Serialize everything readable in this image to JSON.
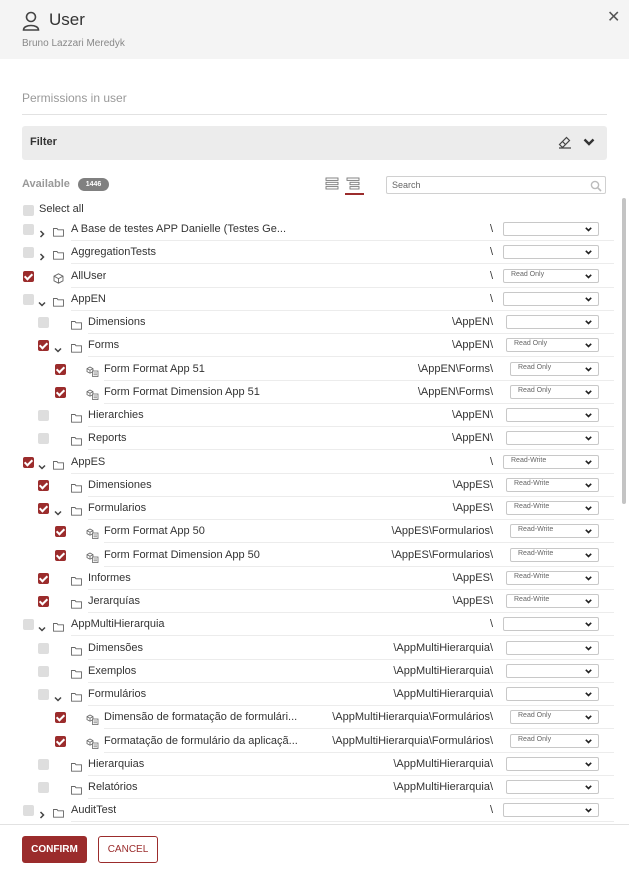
{
  "header": {
    "title": "User",
    "subtitle": "Bruno Lazzari Meredyk",
    "close_symbol": "✕"
  },
  "section_title": "Permissions in user",
  "filter": {
    "label": "Filter"
  },
  "available": {
    "label": "Available",
    "count": "1446"
  },
  "search": {
    "placeholder": "Search"
  },
  "select_all": "Select all",
  "colors": {
    "accent": "#9b2c2c",
    "header_bg": "#f4f4f4",
    "filter_bg": "#ececec"
  },
  "tree": [
    {
      "name": "A Base de testes APP Danielle (Testes Ge...",
      "path": "\\",
      "level": 0,
      "type": "folder",
      "toggle": "collapsed",
      "checked": false,
      "access": ""
    },
    {
      "name": "AggregationTests",
      "path": "\\",
      "level": 0,
      "type": "folder",
      "toggle": "collapsed",
      "checked": false,
      "access": ""
    },
    {
      "name": "AllUser",
      "path": "\\",
      "level": 0,
      "type": "cube",
      "toggle": "none",
      "checked": true,
      "access": "Read Only"
    },
    {
      "name": "AppEN",
      "path": "\\",
      "level": 0,
      "type": "folder",
      "toggle": "expanded",
      "checked": false,
      "access": ""
    },
    {
      "name": "Dimensions",
      "path": "\\AppEN\\",
      "level": 1,
      "type": "folder",
      "toggle": "none",
      "checked": false,
      "access": ""
    },
    {
      "name": "Forms",
      "path": "\\AppEN\\",
      "level": 1,
      "type": "folder",
      "toggle": "expanded",
      "checked": true,
      "access": "Read Only"
    },
    {
      "name": "Form Format App 51",
      "path": "\\AppEN\\Forms\\",
      "level": 2,
      "type": "form",
      "toggle": "none",
      "checked": true,
      "access": "Read Only"
    },
    {
      "name": "Form Format Dimension App 51",
      "path": "\\AppEN\\Forms\\",
      "level": 2,
      "type": "form",
      "toggle": "none",
      "checked": true,
      "access": "Read Only"
    },
    {
      "name": "Hierarchies",
      "path": "\\AppEN\\",
      "level": 1,
      "type": "folder",
      "toggle": "none",
      "checked": false,
      "access": ""
    },
    {
      "name": "Reports",
      "path": "\\AppEN\\",
      "level": 1,
      "type": "folder",
      "toggle": "none",
      "checked": false,
      "access": ""
    },
    {
      "name": "AppES",
      "path": "\\",
      "level": 0,
      "type": "folder",
      "toggle": "expanded",
      "checked": true,
      "access": "Read-Write"
    },
    {
      "name": "Dimensiones",
      "path": "\\AppES\\",
      "level": 1,
      "type": "folder",
      "toggle": "none",
      "checked": true,
      "access": "Read-Write"
    },
    {
      "name": "Formularios",
      "path": "\\AppES\\",
      "level": 1,
      "type": "folder",
      "toggle": "expanded",
      "checked": true,
      "access": "Read-Write"
    },
    {
      "name": "Form Format App 50",
      "path": "\\AppES\\Formularios\\",
      "level": 2,
      "type": "form",
      "toggle": "none",
      "checked": true,
      "access": "Read-Write"
    },
    {
      "name": "Form Format Dimension App 50",
      "path": "\\AppES\\Formularios\\",
      "level": 2,
      "type": "form",
      "toggle": "none",
      "checked": true,
      "access": "Read-Write"
    },
    {
      "name": "Informes",
      "path": "\\AppES\\",
      "level": 1,
      "type": "folder",
      "toggle": "none",
      "checked": true,
      "access": "Read-Write"
    },
    {
      "name": "Jerarquías",
      "path": "\\AppES\\",
      "level": 1,
      "type": "folder",
      "toggle": "none",
      "checked": true,
      "access": "Read-Write"
    },
    {
      "name": "AppMultiHierarquia",
      "path": "\\",
      "level": 0,
      "type": "folder",
      "toggle": "expanded",
      "checked": false,
      "access": ""
    },
    {
      "name": "Dimensões",
      "path": "\\AppMultiHierarquia\\",
      "level": 1,
      "type": "folder",
      "toggle": "none",
      "checked": false,
      "access": ""
    },
    {
      "name": "Exemplos",
      "path": "\\AppMultiHierarquia\\",
      "level": 1,
      "type": "folder",
      "toggle": "none",
      "checked": false,
      "access": ""
    },
    {
      "name": "Formulários",
      "path": "\\AppMultiHierarquia\\",
      "level": 1,
      "type": "folder",
      "toggle": "expanded",
      "checked": false,
      "access": ""
    },
    {
      "name": "Dimensão de formatação de formulári...",
      "path": "\\AppMultiHierarquia\\Formulários\\",
      "level": 2,
      "type": "form",
      "toggle": "none",
      "checked": true,
      "access": "Read Only"
    },
    {
      "name": "Formatação de formulário da aplicaçã...",
      "path": "\\AppMultiHierarquia\\Formulários\\",
      "level": 2,
      "type": "form",
      "toggle": "none",
      "checked": true,
      "access": "Read Only"
    },
    {
      "name": "Hierarquias",
      "path": "\\AppMultiHierarquia\\",
      "level": 1,
      "type": "folder",
      "toggle": "none",
      "checked": false,
      "access": ""
    },
    {
      "name": "Relatórios",
      "path": "\\AppMultiHierarquia\\",
      "level": 1,
      "type": "folder",
      "toggle": "none",
      "checked": false,
      "access": ""
    },
    {
      "name": "AuditTest",
      "path": "\\",
      "level": 0,
      "type": "folder",
      "toggle": "collapsed",
      "checked": false,
      "access": ""
    }
  ],
  "buttons": {
    "confirm": "CONFIRM",
    "cancel": "CANCEL"
  }
}
